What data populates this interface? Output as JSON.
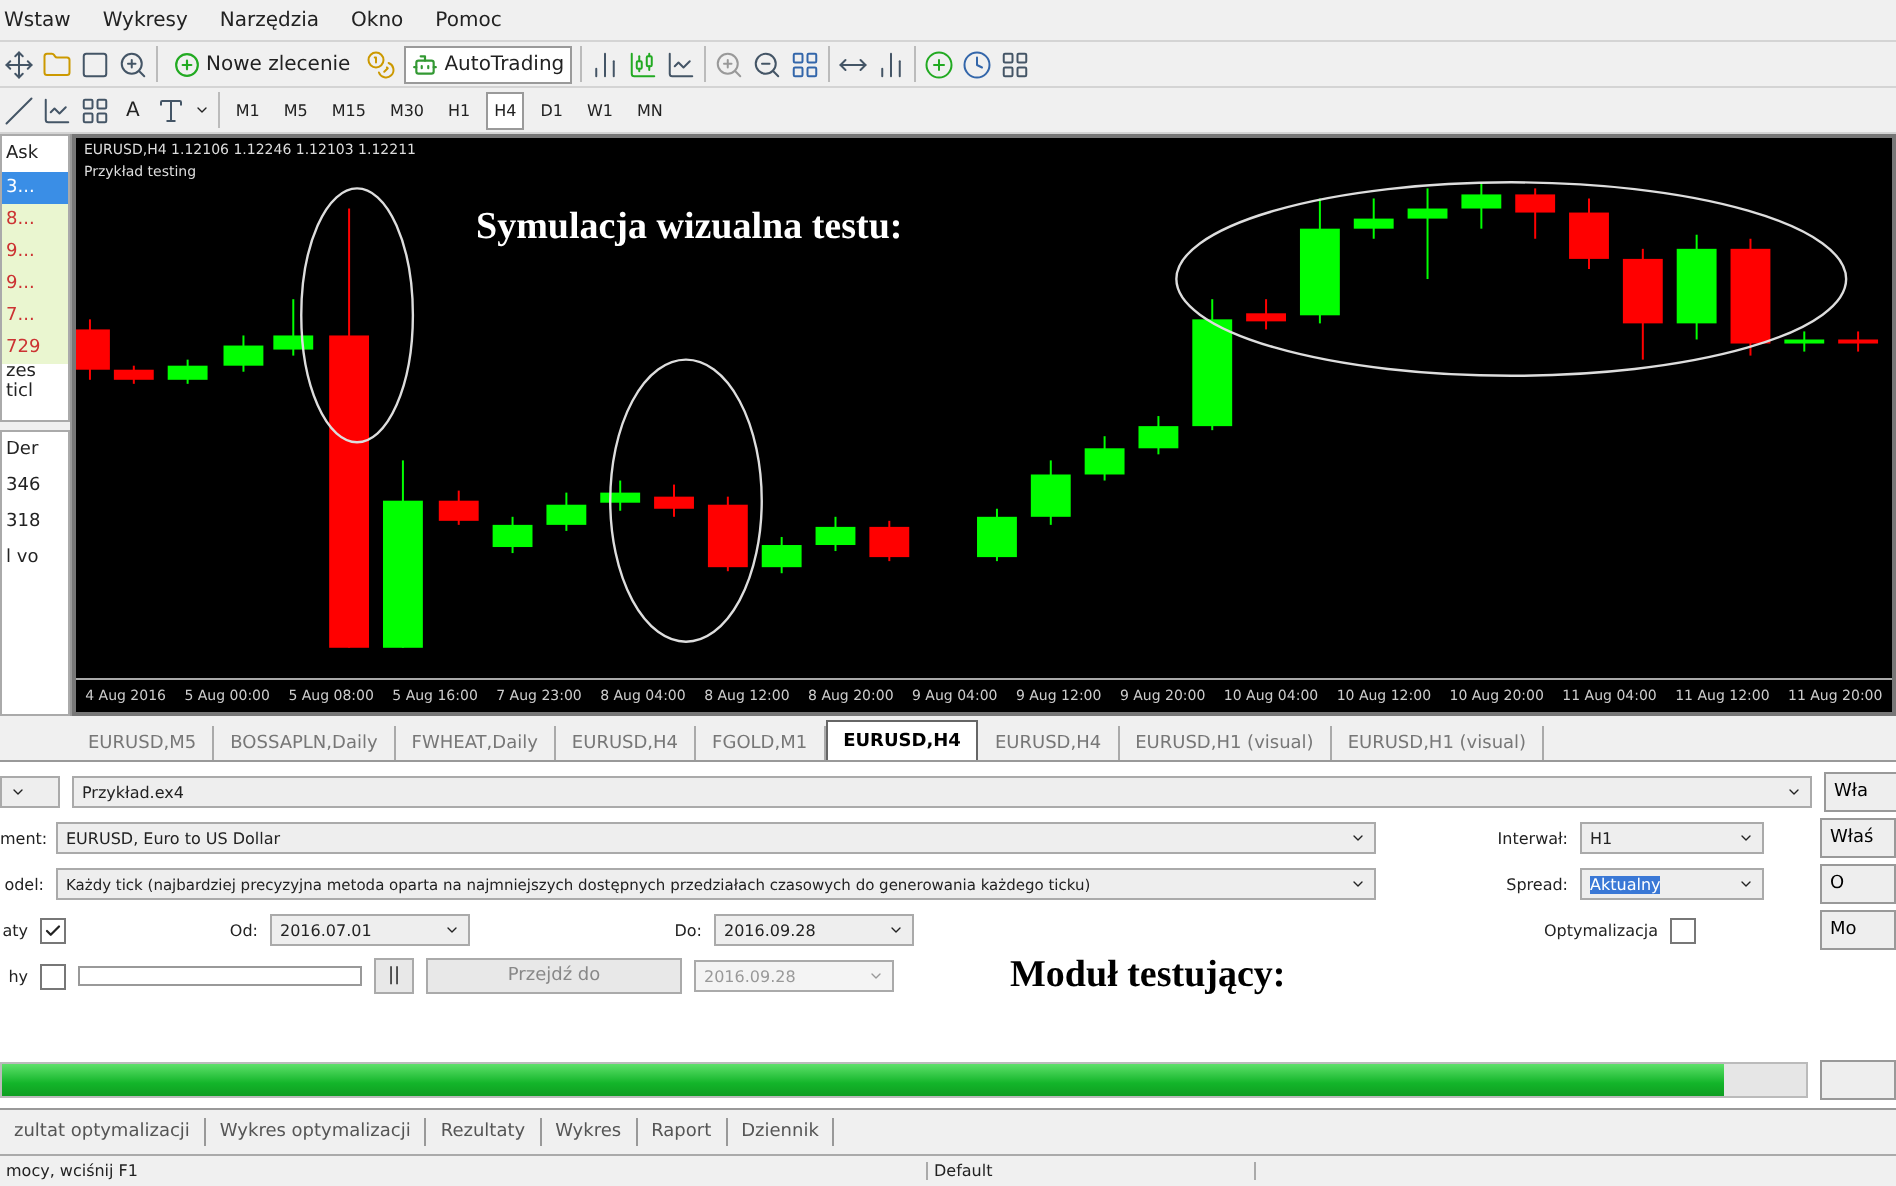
{
  "menu": [
    {
      "label": "Wstaw"
    },
    {
      "label": "Wykresy"
    },
    {
      "label": "Narzędzia"
    },
    {
      "label": "Okno"
    },
    {
      "label": "Pomoc"
    }
  ],
  "toolbar": {
    "buttons": [
      {
        "label": "Nowe zlecenie"
      },
      {
        "label": "AutoTrading"
      }
    ]
  },
  "draw_toolbar": {
    "text_tool": "A"
  },
  "timeframes": [
    {
      "label": "M1",
      "selected": false
    },
    {
      "label": "M5",
      "selected": false
    },
    {
      "label": "M15",
      "selected": false
    },
    {
      "label": "M30",
      "selected": false
    },
    {
      "label": "H1",
      "selected": false
    },
    {
      "label": "H4",
      "selected": true
    },
    {
      "label": "D1",
      "selected": false
    },
    {
      "label": "W1",
      "selected": false
    },
    {
      "label": "MN",
      "selected": false
    }
  ],
  "market_watch": {
    "header": "Ask",
    "quotes": [
      {
        "value": "3...",
        "selected": true
      },
      {
        "value": "8...",
        "selected": false
      },
      {
        "value": "9...",
        "selected": false
      },
      {
        "value": "9...",
        "selected": false
      },
      {
        "value": "7...",
        "selected": false
      },
      {
        "value": "729",
        "selected": false
      }
    ],
    "footer": "zes ticl"
  },
  "navigator": {
    "items": [
      "Der",
      "346",
      "318",
      "l vo"
    ]
  },
  "chart": {
    "header": "EURUSD,H4  1.12106 1.12246 1.12103 1.12211",
    "expert": "Przykład testing",
    "overlay_caption": "Symulacja wizualna testu:",
    "time_labels": [
      "4 Aug 2016",
      "5 Aug 00:00",
      "5 Aug 08:00",
      "5 Aug 16:00",
      "7 Aug 23:00",
      "8 Aug 04:00",
      "8 Aug 12:00",
      "8 Aug 20:00",
      "9 Aug 04:00",
      "9 Aug 12:00",
      "9 Aug 20:00",
      "10 Aug 04:00",
      "10 Aug 12:00",
      "10 Aug 20:00",
      "11 Aug 04:00",
      "11 Aug 12:00",
      "11 Aug 20:00"
    ]
  },
  "chart_tabs": [
    {
      "label": "EURUSD,M5",
      "selected": false
    },
    {
      "label": "BOSSAPLN,Daily",
      "selected": false
    },
    {
      "label": "FWHEAT,Daily",
      "selected": false
    },
    {
      "label": "EURUSD,H4",
      "selected": false
    },
    {
      "label": "FGOLD,M1",
      "selected": false
    },
    {
      "label": "EURUSD,H4",
      "selected": true
    },
    {
      "label": "EURUSD,H4",
      "selected": false
    },
    {
      "label": "EURUSD,H1 (visual)",
      "selected": false
    },
    {
      "label": "EURUSD,H1 (visual)",
      "selected": false
    }
  ],
  "tester": {
    "expert": "Przykład.ex4",
    "symbol_label": "ment:",
    "symbol": "EURUSD, Euro to US Dollar",
    "model_label": "odel:",
    "model": "Każdy tick (najbardziej precyzyjna metoda oparta na najmniejszych dostępnych przedziałach czasowych do generowania każdego ticku)",
    "period_label": "Interwał:",
    "period": "H1",
    "spread_label": "Spread:",
    "spread": "Aktualny",
    "use_date": {
      "label": "aty",
      "checked": true
    },
    "from_label": "Od:",
    "from": "2016.07.01",
    "to_label": "Do:",
    "to": "2016.09.28",
    "optimization": {
      "label": "Optymalizacja",
      "checked": false
    },
    "visual": {
      "label": "hy",
      "checked": false
    },
    "speed": {
      "level": 0
    },
    "pause": "||",
    "skip_button": {
      "label": "Przejdź do",
      "disabled": true
    },
    "skip_date": {
      "value": "2016.09.28",
      "disabled": true
    },
    "side_buttons": [
      "Wła",
      "Właś",
      "O",
      "Mo"
    ],
    "overlay_caption": "Moduł testujący:",
    "progress": {
      "level": 0.955
    }
  },
  "tester_tabs": [
    {
      "label": "zultat optymalizacji",
      "selected": false
    },
    {
      "label": "Wykres optymalizacji",
      "selected": false
    },
    {
      "label": "Rezultaty",
      "selected": false
    },
    {
      "label": "Wykres",
      "selected": false
    },
    {
      "label": "Raport",
      "selected": false
    },
    {
      "label": "Dziennik",
      "selected": false
    }
  ],
  "status_bar": {
    "help": "mocy, wciśnij F1",
    "profile": "Default"
  }
}
